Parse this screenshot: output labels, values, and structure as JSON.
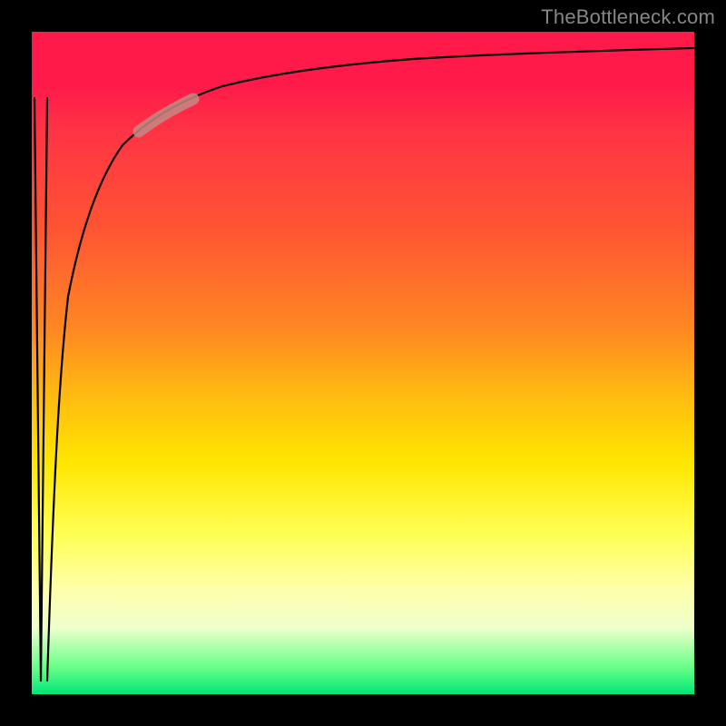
{
  "watermark": "TheBottleneck.com",
  "colors": {
    "background": "#000000",
    "gradient_top": "#ff1a4a",
    "gradient_mid1": "#ff8822",
    "gradient_mid2": "#ffff55",
    "gradient_bottom": "#00e676",
    "curve": "#000000",
    "highlight_segment": "#c48a82"
  },
  "chart_data": {
    "type": "line",
    "title": "",
    "xlabel": "",
    "ylabel": "",
    "xlim": [
      0,
      100
    ],
    "ylim": [
      0,
      100
    ],
    "grid": false,
    "legend": false,
    "series": [
      {
        "name": "spike_down",
        "x": [
          0,
          1,
          2
        ],
        "y": [
          90,
          2,
          90
        ]
      },
      {
        "name": "main_curve",
        "x": [
          2,
          5,
          8,
          12,
          16,
          20,
          25,
          30,
          40,
          50,
          60,
          70,
          80,
          90,
          100
        ],
        "y": [
          2,
          40,
          60,
          72,
          80,
          84,
          87,
          89,
          92,
          93.5,
          94.5,
          95.2,
          95.8,
          96.3,
          96.8
        ]
      }
    ],
    "highlight_segment": {
      "series": "main_curve",
      "x_start": 16,
      "x_end": 24,
      "note": "thicker semi-opaque reddish-brown stroke overlay"
    }
  }
}
